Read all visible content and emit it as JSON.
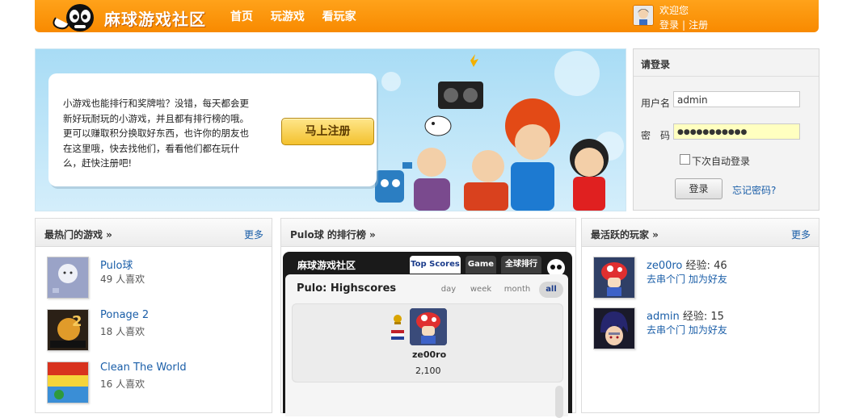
{
  "header": {
    "logo_text": "麻球游戏社区",
    "nav": [
      "首页",
      "玩游戏",
      "看玩家"
    ],
    "welcome": "欢迎您",
    "login_link": "登录",
    "separator": "|",
    "register_link": "注册"
  },
  "banner": {
    "text": "小游戏也能排行和奖牌啦？没错，每天都会更新好玩耐玩的小游戏，并且都有排行榜的哦。更可以赚取积分换取好东西，也许你的朋友也在这里哦，快去找他们，看看他们都在玩什么，赶快注册吧!",
    "signup_button": "马上注册"
  },
  "login": {
    "title": "请登录",
    "username_label": "用户名",
    "username_value": "admin",
    "password_label": "密　码",
    "password_value": "●●●●●●●●●●●",
    "remember_label": "下次自动登录",
    "submit": "登录",
    "forgot": "忘记密码?"
  },
  "hot_games": {
    "title": "最热门的游戏 »",
    "more": "更多",
    "items": [
      {
        "name": "Pulo球",
        "likes": "49 人喜欢",
        "thumb": "pulo-thumbnail"
      },
      {
        "name": "Ponage 2",
        "likes": "18 人喜欢",
        "thumb": "ponage-thumbnail"
      },
      {
        "name": "Clean The World",
        "likes": "16 人喜欢",
        "thumb": "clean-the-world-thumbnail"
      }
    ]
  },
  "leaderboard": {
    "title": "Pulo球 的排行榜 »",
    "widget_brand": "麻球游戏社区",
    "tabs": [
      "Top Scores",
      "Game",
      "全球排行"
    ],
    "heading": "Pulo: Highscores",
    "periods": [
      "day",
      "week",
      "month",
      "all"
    ],
    "selected_period": "all",
    "top_player": {
      "name": "ze00ro",
      "score": "2,100"
    }
  },
  "active_players": {
    "title": "最活跃的玩家 »",
    "more": "更多",
    "exp_label": "经验:",
    "actions": [
      "去串个门",
      "加为好友"
    ],
    "items": [
      {
        "name": "ze00ro",
        "exp": "46"
      },
      {
        "name": "admin",
        "exp": "15"
      }
    ]
  },
  "colors": {
    "header_orange": "#f88a00",
    "link_blue": "#1a5ea8",
    "button_gold": "#f3c12e"
  }
}
